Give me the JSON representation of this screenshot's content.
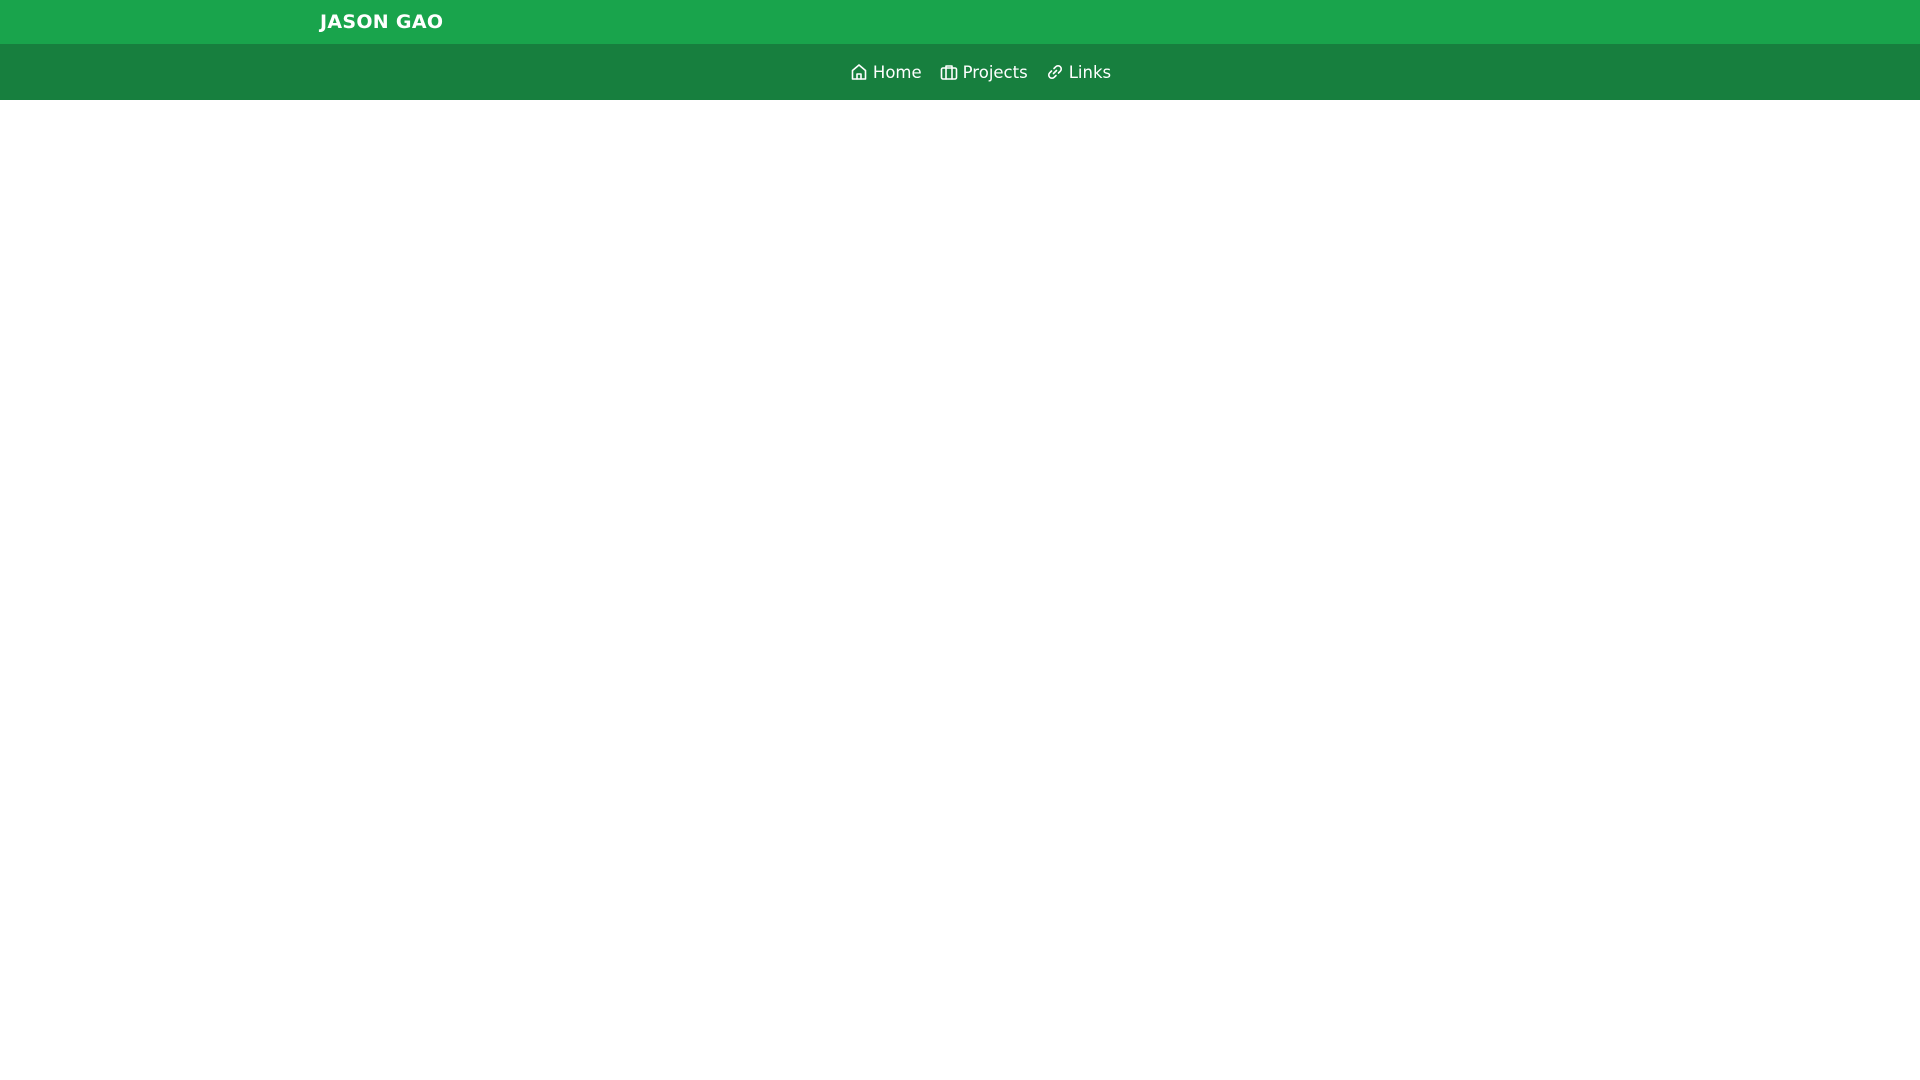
{
  "header": {
    "brand": "JASON GAO"
  },
  "nav": {
    "items": [
      {
        "label": "Home",
        "icon": "home-icon"
      },
      {
        "label": "Projects",
        "icon": "briefcase-icon"
      },
      {
        "label": "Links",
        "icon": "link-icon"
      }
    ]
  },
  "colors": {
    "topbar": "#19a44c",
    "navbar": "#177f3e",
    "text": "#ffffff",
    "background": "#ffffff"
  }
}
